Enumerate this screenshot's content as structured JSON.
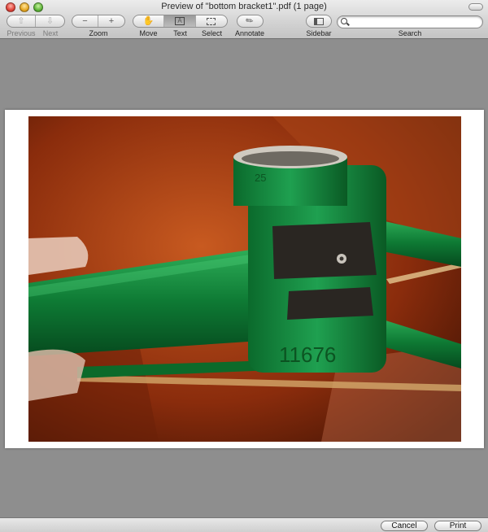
{
  "window": {
    "title": "Preview of \"bottom bracket1\".pdf (1 page)"
  },
  "toolbar": {
    "previous_label": "Previous",
    "next_label": "Next",
    "zoom_label": "Zoom",
    "zoom_out_glyph": "−",
    "zoom_in_glyph": "+",
    "move_label": "Move",
    "text_label": "Text",
    "text_glyph": "A",
    "select_label": "Select",
    "annotate_label": "Annotate",
    "sidebar_label": "Sidebar",
    "search_label": "Search",
    "search_value": "",
    "active_tool": "text"
  },
  "photo": {
    "stamp_text": "11676",
    "stamp_small": "25"
  },
  "footer": {
    "cancel_label": "Cancel",
    "print_label": "Print"
  }
}
